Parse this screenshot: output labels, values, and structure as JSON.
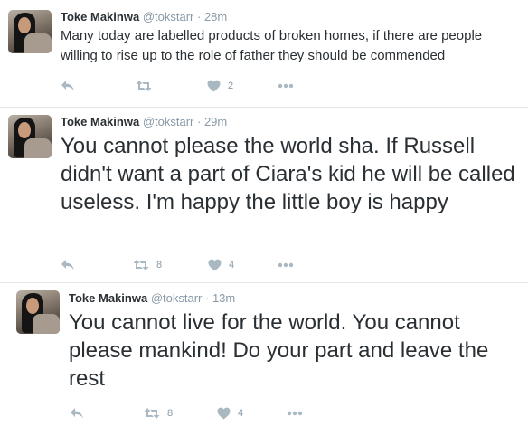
{
  "tweets": [
    {
      "name": "Toke Makinwa",
      "handle": "@tokstarr",
      "sep": "·",
      "time": "28m",
      "text": "Many today are labelled products of broken homes, if there are people willing to rise up to the role of father they should be commended",
      "retweets": "",
      "likes": "2"
    },
    {
      "name": "Toke Makinwa",
      "handle": "@tokstarr",
      "sep": "·",
      "time": "29m",
      "text": "You cannot please the world sha. If Russell didn't want a part of Ciara's kid he will be called useless. I'm happy the little boy is happy",
      "retweets": "8",
      "likes": "4"
    },
    {
      "name": "Toke Makinwa",
      "handle": "@tokstarr",
      "sep": "·",
      "time": "13m",
      "text": "You cannot live for the world. You cannot please mankind! Do your part and leave the rest",
      "retweets": "8",
      "likes": "4"
    }
  ],
  "icons": {
    "reply": "reply-icon",
    "retweet": "retweet-icon",
    "like": "heart-icon",
    "more": "more-icon"
  },
  "colors": {
    "name": "#292f33",
    "meta": "#8899a6",
    "icon": "#aab8c2",
    "divider": "#e1e8ed"
  }
}
